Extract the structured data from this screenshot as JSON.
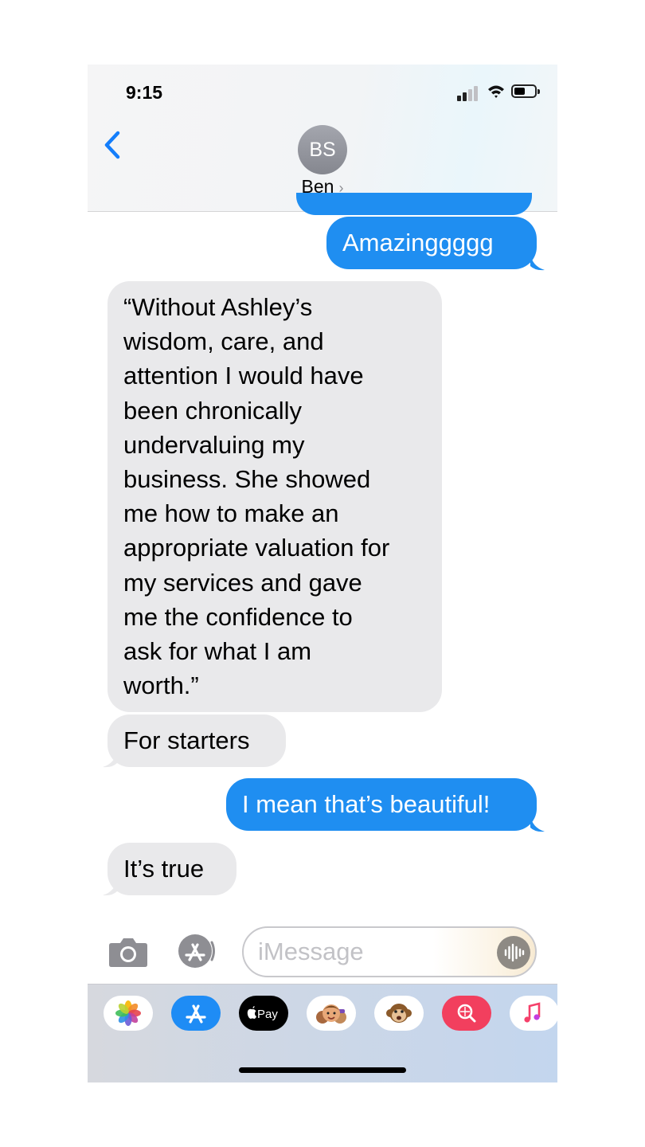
{
  "status_bar": {
    "time": "9:15",
    "battery_level": 0.55
  },
  "header": {
    "avatar_initials": "BS",
    "contact_name": "Ben",
    "contact_chevron": "›",
    "back_icon": "chevron-left-icon"
  },
  "messages": [
    {
      "sender": "me",
      "text": "Amazinggggg"
    },
    {
      "sender": "them",
      "text": "“Without Ashley’s\nwisdom, care, and\nattention I would have\nbeen chronically\nundervaluing my\nbusiness. She showed\nme how to make an\nappropriate valuation for\nmy services and gave\nme the confidence to\nask for what I am\nworth.”"
    },
    {
      "sender": "them",
      "text": "For starters"
    },
    {
      "sender": "me",
      "text": "I mean that’s beautiful!"
    },
    {
      "sender": "them",
      "text": "It’s true"
    }
  ],
  "composer": {
    "placeholder": "iMessage",
    "camera_icon": "camera-icon",
    "apps_icon": "app-store-icon",
    "audio_icon": "audio-waveform-icon"
  },
  "app_drawer": {
    "apps": [
      {
        "name": "Photos",
        "icon": "photos-icon"
      },
      {
        "name": "App Store",
        "icon": "app-store-icon"
      },
      {
        "name": "Apple Pay",
        "icon": "apple-pay-icon",
        "label": "Pay"
      },
      {
        "name": "Memoji",
        "icon": "memoji-icon"
      },
      {
        "name": "Animoji",
        "icon": "monkey-animoji-icon"
      },
      {
        "name": "Search Images",
        "icon": "image-search-icon"
      },
      {
        "name": "Music",
        "icon": "music-icon"
      }
    ]
  },
  "colors": {
    "sent_bubble": "#1f8ef1",
    "received_bubble": "#e9e9eb",
    "accent": "#147efb"
  }
}
